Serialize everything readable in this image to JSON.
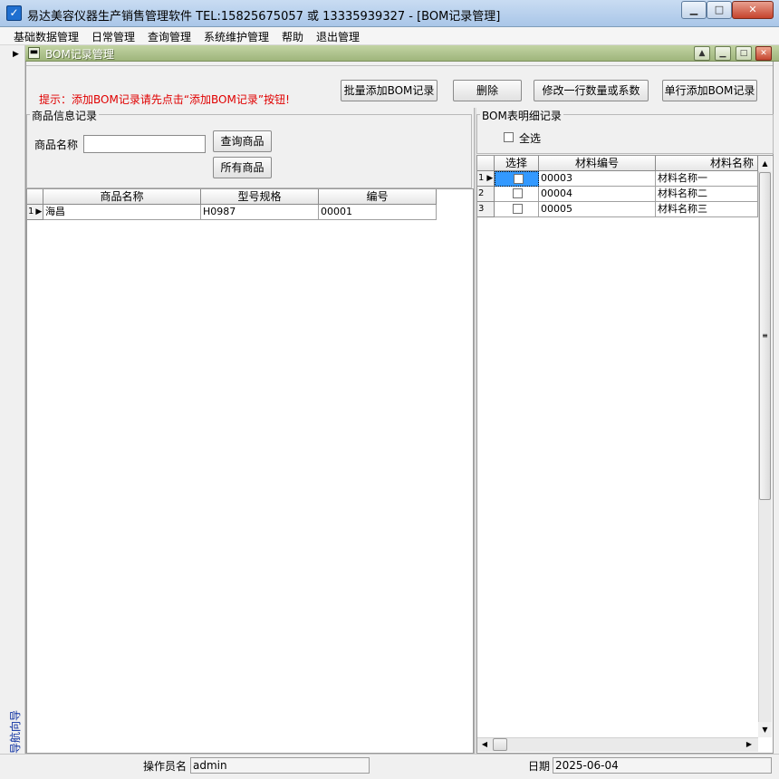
{
  "window": {
    "title": "易达美容仪器生产销售管理软件  TEL:15825675057 或 13335939327   - [BOM记录管理]",
    "icon": "app-icon"
  },
  "menu": [
    "基础数据管理",
    "日常管理",
    "查询管理",
    "系统维护管理",
    "帮助",
    "退出管理"
  ],
  "nav_strip": {
    "label": "导航向导"
  },
  "child_window": {
    "title": "BOM记录管理"
  },
  "hint": "提示：添加BOM记录请先点击“添加BOM记录”按钮!",
  "toolbar": {
    "batch_add": "批量添加BOM记录",
    "delete": "删除",
    "modify_row": "修改一行数量或系数",
    "single_add": "单行添加BOM记录"
  },
  "goods_panel": {
    "title": "商品信息记录",
    "name_label": "商品名称",
    "name_value": "",
    "query_button": "查询商品",
    "all_button": "所有商品",
    "columns": [
      "商品名称",
      "型号规格",
      "编号"
    ],
    "rows": [
      {
        "row_no": "1",
        "name": "海昌",
        "spec": "H0987",
        "code": "00001"
      }
    ]
  },
  "bom_panel": {
    "title": "BOM表明细记录",
    "select_all_label": "全选",
    "columns": [
      "选择",
      "材料编号",
      "材料名称"
    ],
    "rows": [
      {
        "row_no": "1",
        "code": "00003",
        "name": "材料名称一"
      },
      {
        "row_no": "2",
        "code": "00004",
        "name": "材料名称二"
      },
      {
        "row_no": "3",
        "code": "00005",
        "name": "材料名称三"
      }
    ]
  },
  "status": {
    "operator_label": "操作员名",
    "operator_value": "admin",
    "date_label": "日期",
    "date_value": "2025-06-04"
  },
  "colors": {
    "hint": "#e00000",
    "nav_label": "#0a2ea0",
    "child_titlebar": "#9fb57b",
    "grid_selection": "#3399ff"
  }
}
